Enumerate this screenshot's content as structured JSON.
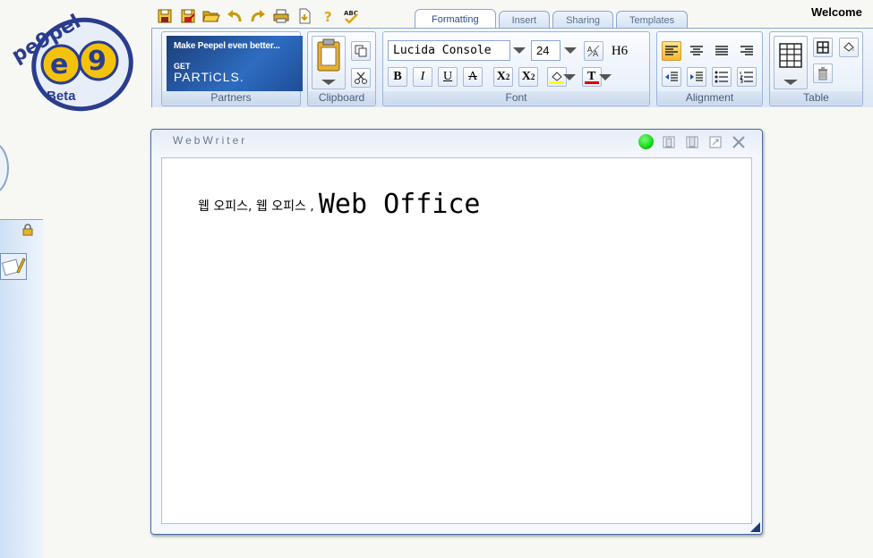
{
  "app": {
    "logo_text": "pe9pel",
    "logo_badge": "Beta",
    "welcome": "Welcome"
  },
  "tabs": [
    {
      "label": "Formatting",
      "active": true
    },
    {
      "label": "Insert",
      "active": false
    },
    {
      "label": "Sharing",
      "active": false
    },
    {
      "label": "Templates",
      "active": false
    }
  ],
  "quick_toolbar": [
    "save-icon",
    "save-as-icon",
    "open-folder-icon",
    "undo-icon",
    "redo-icon",
    "print-icon",
    "export-icon",
    "help-icon",
    "spellcheck-icon"
  ],
  "ribbon": {
    "partners": {
      "label": "Partners",
      "banner_line1": "Make Peepel even better...",
      "banner_line2": "GET",
      "banner_line3": "PARTiCLS."
    },
    "clipboard": {
      "label": "Clipboard"
    },
    "font": {
      "label": "Font",
      "family": "Lucida Console",
      "size": "24",
      "heading": "H6",
      "bold": "B",
      "italic": "I",
      "underline": "U",
      "strike": "A",
      "subscript": "X",
      "subscript_mark": "2",
      "superscript": "X",
      "superscript_mark": "2",
      "text_color_glyph": "T",
      "highlight_color": "#ffff00",
      "text_color": "#e00000"
    },
    "alignment": {
      "label": "Alignment"
    },
    "table": {
      "label": "Table"
    }
  },
  "window": {
    "title": "WebWriter",
    "status_color": "#17d517"
  },
  "document": {
    "korean_text": "웹 오피스, 웹  오피스  ,",
    "english_text": "Web Office"
  }
}
